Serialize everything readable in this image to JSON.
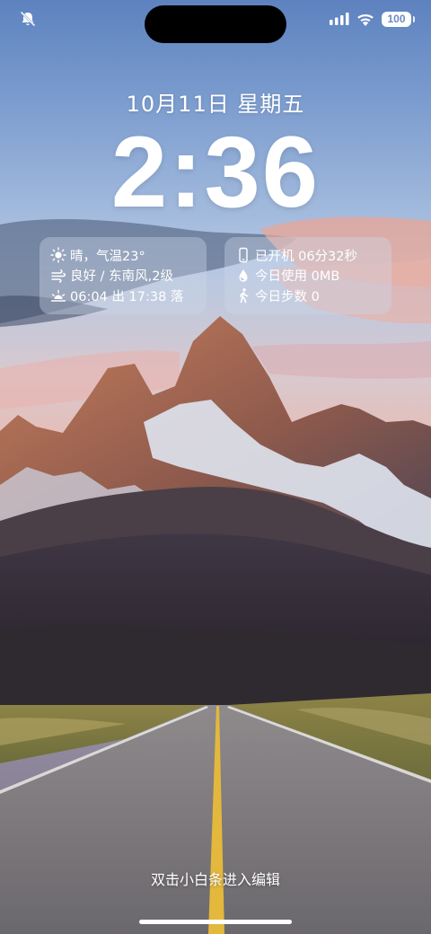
{
  "status_bar": {
    "mute_icon": "bell-slash-icon",
    "signal_icon": "cellular-signal-icon",
    "wifi_icon": "wifi-icon",
    "battery_level": "100"
  },
  "lock_screen": {
    "date": "10月11日 星期五",
    "time": "2:36"
  },
  "widgets": {
    "weather": {
      "condition_temp": "晴，气温23°",
      "air_wind": "良好 / 东南风,2级",
      "sunrise_sunset": "06:04 出 17:38 落",
      "icons": [
        "sun-icon",
        "wind-icon",
        "sunrise-icon"
      ]
    },
    "device": {
      "uptime": "已开机 06分32秒",
      "data_usage": "今日使用 0MB",
      "steps": "今日步数 0",
      "icons": [
        "phone-icon",
        "water-drop-icon",
        "walking-icon"
      ]
    }
  },
  "hint": "双击小白条进入编辑",
  "colors": {
    "sky_top": "#5b80bd",
    "sky_mid": "#a9bfe0",
    "cloud_pink": "#f1b1a2",
    "mountain_rock": "#a56a50",
    "road": "#7f7b7e",
    "road_line": "#e3b83c"
  }
}
